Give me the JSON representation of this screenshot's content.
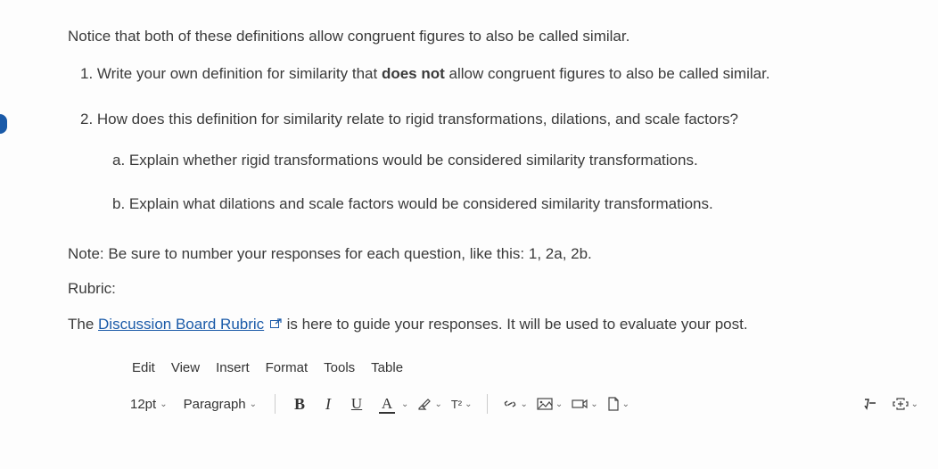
{
  "content": {
    "intro": "Notice that both of these definitions allow congruent figures to also be called similar.",
    "q1_num": "1. ",
    "q1_before": "Write your own definition for similarity that ",
    "q1_bold": "does not",
    "q1_after": " allow congruent figures to also be called similar.",
    "q2": "2. How does this definition for similarity relate to rigid transformations, dilations, and scale factors?",
    "q2a": "a. Explain whether rigid transformations would be considered similarity transformations.",
    "q2b": "b. Explain what dilations and scale factors would be considered similarity transformations.",
    "note": "Note: Be sure to number your responses for each question, like this: 1, 2a, 2b.",
    "rubric_label": "Rubric:",
    "rubric_before": "The ",
    "rubric_link": "Discussion Board Rubric",
    "rubric_after": " is here to guide your responses. It will be used to evaluate your post."
  },
  "editor": {
    "menu": {
      "edit": "Edit",
      "view": "View",
      "insert": "Insert",
      "format": "Format",
      "tools": "Tools",
      "table": "Table"
    },
    "toolbar": {
      "font_size": "12pt",
      "block_format": "Paragraph",
      "bold": "B",
      "italic": "I",
      "underline": "U",
      "text_color": "A",
      "superscript": "T²"
    }
  }
}
